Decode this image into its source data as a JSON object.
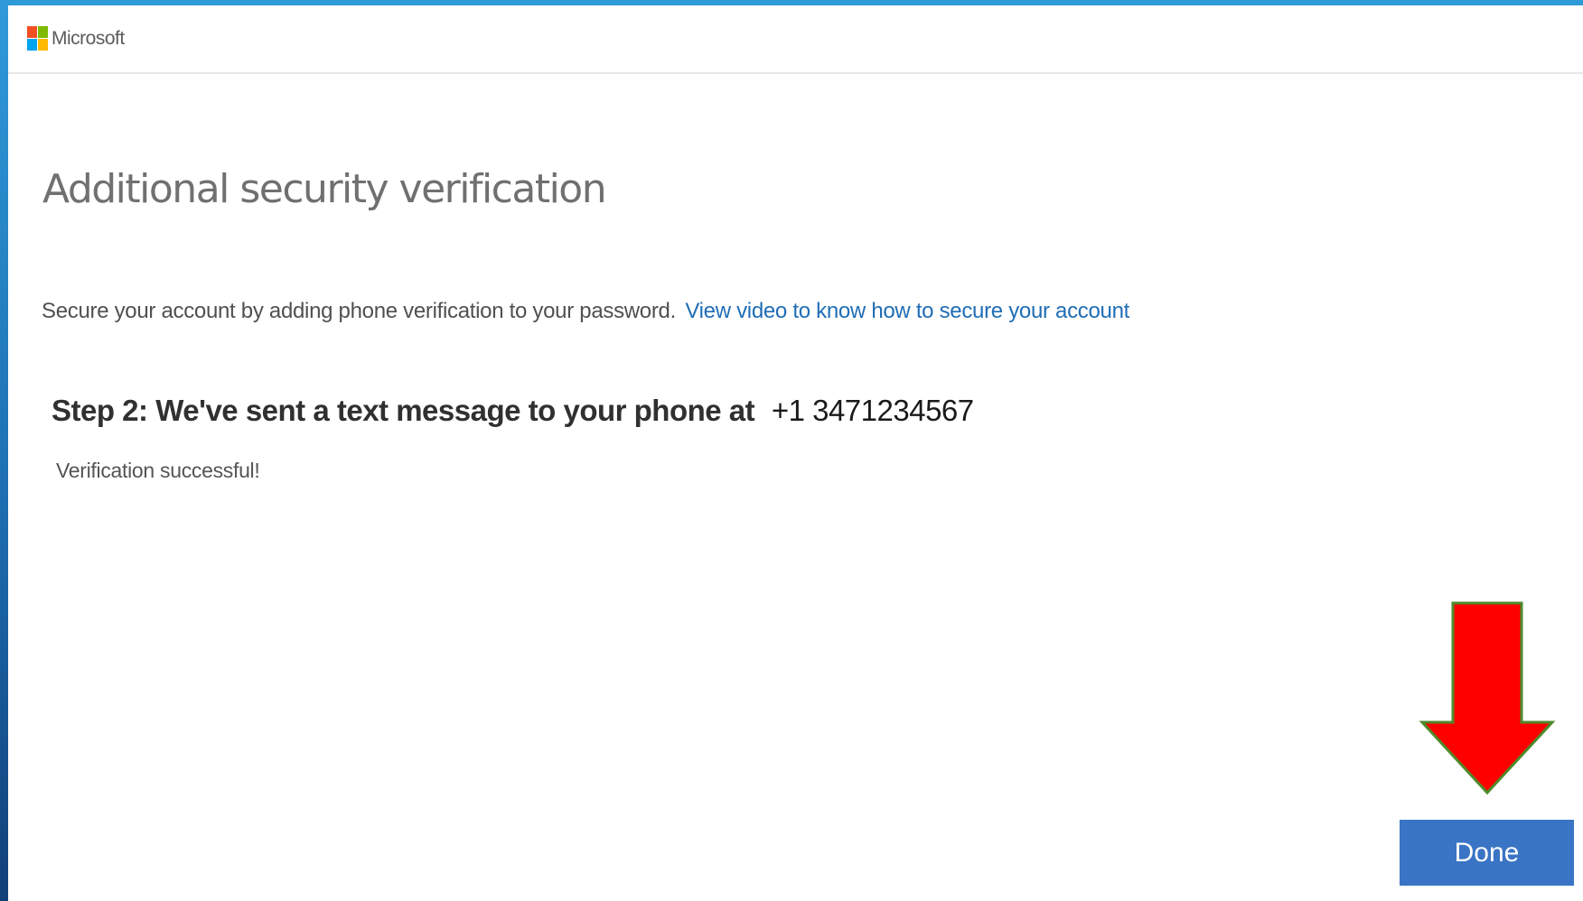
{
  "brand": {
    "name": "Microsoft",
    "logo_colors": [
      "#f25022",
      "#7fba00",
      "#00a4ef",
      "#ffb900"
    ]
  },
  "page": {
    "title": "Additional security verification",
    "intro_text": "Secure your account by adding phone verification to your password.",
    "intro_link": "View video to know how to secure your account",
    "step_text": "Step 2: We've sent a text message to your phone at",
    "phone_number": "+1 3471234567",
    "status_message": "Verification successful!"
  },
  "actions": {
    "done_label": "Done"
  },
  "colors": {
    "link": "#1f6db5",
    "button": "#3a74c4",
    "annotation_arrow": "#ff0000"
  },
  "annotations": {
    "arrow_icon": "down-arrow-icon"
  }
}
